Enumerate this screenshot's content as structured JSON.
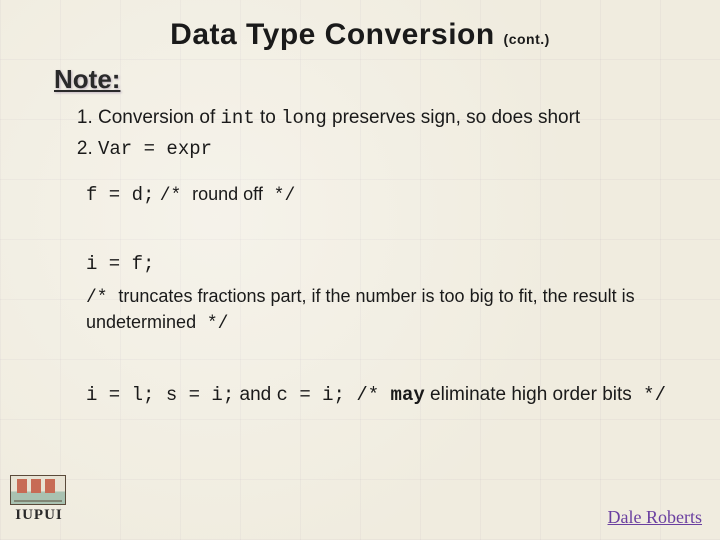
{
  "title": {
    "main": "Data Type Conversion",
    "cont": "(cont.)"
  },
  "note_label": "Note:",
  "points": {
    "p1_prefix": "Conversion of ",
    "p1_code1": "int",
    "p1_mid": " to ",
    "p1_code2": "long",
    "p1_suffix": " preserves sign, so does short",
    "p2": "Var = expr"
  },
  "ex1": {
    "code": "f = d;",
    "comment_open": "/* ",
    "comment_text": "round off",
    "comment_close": " */"
  },
  "ex2": {
    "code": "i = f;",
    "c_open": "/*  ",
    "c_text": "truncates fractions part, if the number is too big to fit, the result is undetermined",
    "c_close": " */"
  },
  "ex3": {
    "c1": "i = l;",
    "c2": " s = i;",
    "and": " and ",
    "c3": "c = i;",
    "comment_open": " /* ",
    "may": "may",
    "comment_text": " eliminate high order bits",
    "comment_close": " */"
  },
  "footer": {
    "author": "Dale Roberts",
    "logo_text": "IUPUI"
  }
}
